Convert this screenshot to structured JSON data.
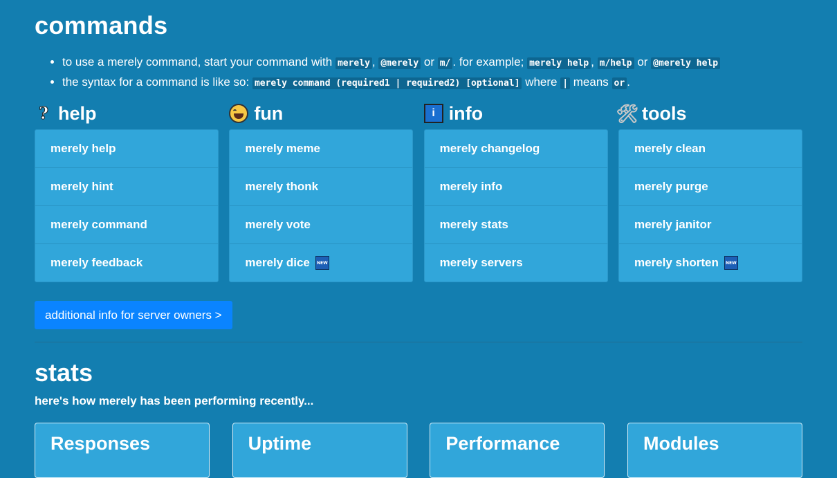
{
  "commands": {
    "title": "commands",
    "note1": {
      "t1": "to use a merely command, start your command with ",
      "c1": "merely",
      "t2": ", ",
      "c2": "@merely",
      "t3": " or ",
      "c3": "m/",
      "t4": ". for example; ",
      "c4": "merely help",
      "t5": ", ",
      "c5": "m/help",
      "t6": " or ",
      "c6": "@merely help"
    },
    "note2": {
      "t1": "the syntax for a command is like so: ",
      "c1": "merely command (required1 | required2) [optional]",
      "t2": " where ",
      "c2": "|",
      "t3": " means ",
      "c3": "or",
      "t4": "."
    },
    "categories": [
      {
        "name": "help",
        "icon": "question-icon",
        "items": [
          "merely help",
          "merely hint",
          "merely command",
          "merely feedback"
        ]
      },
      {
        "name": "fun",
        "icon": "laughing-face-icon",
        "items": [
          "merely meme",
          "merely thonk",
          "merely vote",
          "merely dice"
        ]
      },
      {
        "name": "info",
        "icon": "info-icon",
        "items": [
          "merely changelog",
          "merely info",
          "merely stats",
          "merely servers"
        ]
      },
      {
        "name": "tools",
        "icon": "tools-icon",
        "items": [
          "merely clean",
          "merely purge",
          "merely janitor",
          "merely shorten"
        ]
      }
    ],
    "new_badge": "NEW",
    "icon_glyphs": {
      "help": "?",
      "info": "i",
      "tools": "🛠"
    },
    "owners_button": "additional info for server owners >"
  },
  "stats": {
    "title": "stats",
    "subtitle": "here's how merely has been performing recently...",
    "cards": [
      "Responses",
      "Uptime",
      "Performance",
      "Modules"
    ]
  }
}
